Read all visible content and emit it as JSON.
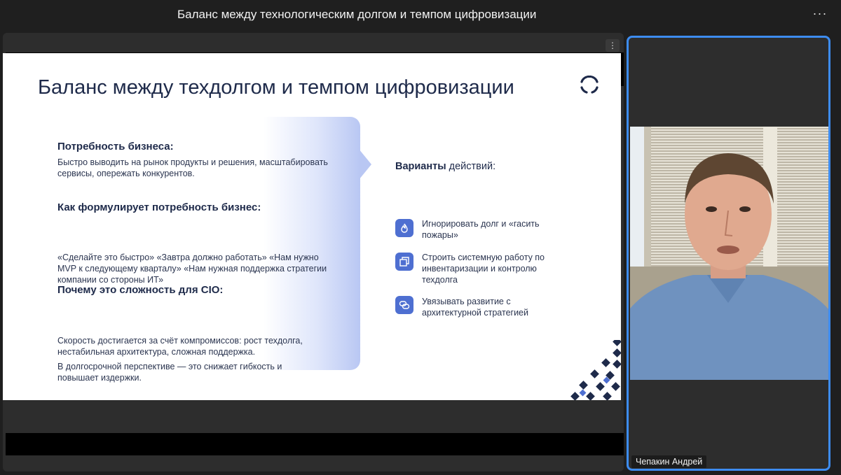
{
  "meeting": {
    "title": "Баланс между технологическим долгом и темпом цифровизации",
    "more_label": "···"
  },
  "share": {
    "more_label": "⋮"
  },
  "slide": {
    "title": "Баланс между техдолгом и темпом цифровизации",
    "sections": [
      {
        "heading": "Потребность бизнеса:",
        "paragraphs": [
          "Быстро выводить на рынок продукты и решения, масштабировать сервисы, опережать конкурентов."
        ]
      },
      {
        "heading": "Как формулирует потребность бизнес:",
        "paragraphs": [
          "«Сделайте это быстро» «Завтра должно работать» «Нам нужно MVP к следующему кварталу» «Нам нужная поддержка стратегии компании со стороны ИТ»"
        ]
      },
      {
        "heading": "Почему это сложность для CIO:",
        "paragraphs": [
          "Скорость достигается за счёт компромиссов: рост техдолга, нестабильная архитектура, сложная поддержка.",
          "В долгосрочной перспективе — это снижает гибкость и повышает издержки."
        ]
      }
    ],
    "variants": {
      "heading_bold": "Варианты",
      "heading_rest": " действий:",
      "options": [
        {
          "icon": "fire-drop-icon",
          "text": "Игнорировать долг и «гасить пожары»"
        },
        {
          "icon": "inventory-icon",
          "text": "Строить системную работу по инвентаризации и контролю техдолга"
        },
        {
          "icon": "link-icon",
          "text": "Увязывать развитие с архитектурной стратегией"
        }
      ]
    },
    "colors": {
      "title": "#1e2a4a",
      "accent": "#4e6fd1",
      "navy": "#1e2a4a"
    }
  },
  "participant": {
    "name": "Чепакин Андрей"
  },
  "colors": {
    "active_speaker_border": "#3d8cf0"
  }
}
